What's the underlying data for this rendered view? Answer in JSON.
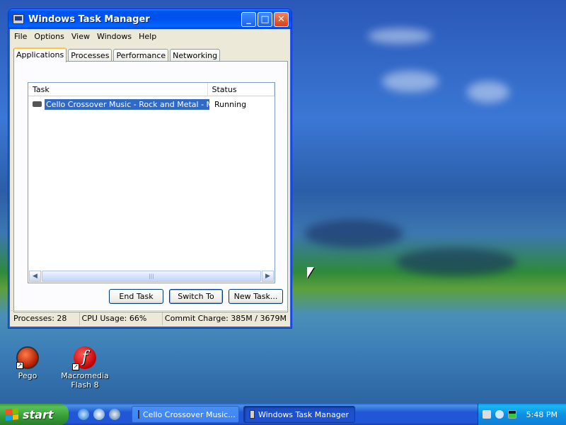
{
  "window": {
    "title": "Windows Task Manager",
    "min_glyph": "_",
    "max_glyph": "□",
    "close_glyph": "✕"
  },
  "menu": [
    "File",
    "Options",
    "View",
    "Windows",
    "Help"
  ],
  "tabs": [
    {
      "label": "Applications",
      "active": true
    },
    {
      "label": "Processes",
      "active": false
    },
    {
      "label": "Performance",
      "active": false
    },
    {
      "label": "Networking",
      "active": false
    }
  ],
  "list": {
    "columns": {
      "task": "Task",
      "status": "Status"
    },
    "rows": [
      {
        "task": "Cello Crossover Music - Rock and Metal - Mypal",
        "status": "Running",
        "selected": true
      }
    ],
    "scroll_left": "◀",
    "scroll_right": "▶",
    "scroll_grip": "|||"
  },
  "buttons": {
    "end_task": "End Task",
    "switch_to": "Switch To",
    "new_task": "New Task..."
  },
  "statusbar": {
    "processes": "Processes: 28",
    "cpu": "CPU Usage: 66%",
    "commit": "Commit Charge: 385M / 3679M"
  },
  "desktop_icons": [
    {
      "label": "Pego",
      "icon": "pego-icon"
    },
    {
      "label": "Macromedia Flash 8",
      "icon": "flash-icon",
      "glyph": "f"
    }
  ],
  "taskbar": {
    "start_label": "start",
    "tasks": [
      {
        "label": "Cello Crossover Music...",
        "active": false
      },
      {
        "label": "Windows Task Manager",
        "active": true
      }
    ],
    "clock": "5:48 PM"
  },
  "colors": {
    "selection": "#316ac5",
    "titlebar": "#0053ee",
    "start_green": "#379c37",
    "taskbar_blue": "#2157d7"
  }
}
